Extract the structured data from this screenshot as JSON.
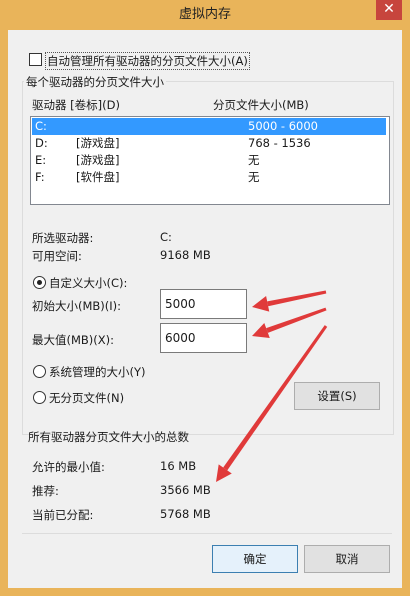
{
  "window": {
    "title": "虚拟内存",
    "close_glyph": "✕"
  },
  "auto_manage": {
    "label": "自动管理所有驱动器的分页文件大小(A)",
    "checked": false
  },
  "drives_group": {
    "title": "每个驱动器的分页文件大小",
    "col_drive": "驱动器 [卷标](D)",
    "col_size": "分页文件大小(MB)",
    "rows": [
      {
        "drive": "C:",
        "label": "",
        "size": "5000 - 6000",
        "selected": true
      },
      {
        "drive": "D:",
        "label": "[游戏盘]",
        "size": "768 - 1536",
        "selected": false
      },
      {
        "drive": "E:",
        "label": "[游戏盘]",
        "size": "无",
        "selected": false
      },
      {
        "drive": "F:",
        "label": "[软件盘]",
        "size": "无",
        "selected": false
      }
    ]
  },
  "selected_drive": {
    "label": "所选驱动器:",
    "value": "C:"
  },
  "free_space": {
    "label": "可用空间:",
    "value": "9168 MB"
  },
  "custom_size": {
    "label": "自定义大小(C):",
    "checked": true
  },
  "initial_size": {
    "label": "初始大小(MB)(I):",
    "value": "5000"
  },
  "max_size": {
    "label": "最大值(MB)(X):",
    "value": "6000"
  },
  "system_managed": {
    "label": "系统管理的大小(Y)",
    "checked": false
  },
  "no_paging": {
    "label": "无分页文件(N)",
    "checked": false
  },
  "set_button": "设置(S)",
  "totals_group": {
    "title": "所有驱动器分页文件大小的总数",
    "min_label": "允许的最小值:",
    "min_value": "16 MB",
    "rec_label": "推荐:",
    "rec_value": "3566 MB",
    "cur_label": "当前已分配:",
    "cur_value": "5768 MB"
  },
  "ok_button": "确定",
  "cancel_button": "取消",
  "annotation_color": "#e03a3a"
}
